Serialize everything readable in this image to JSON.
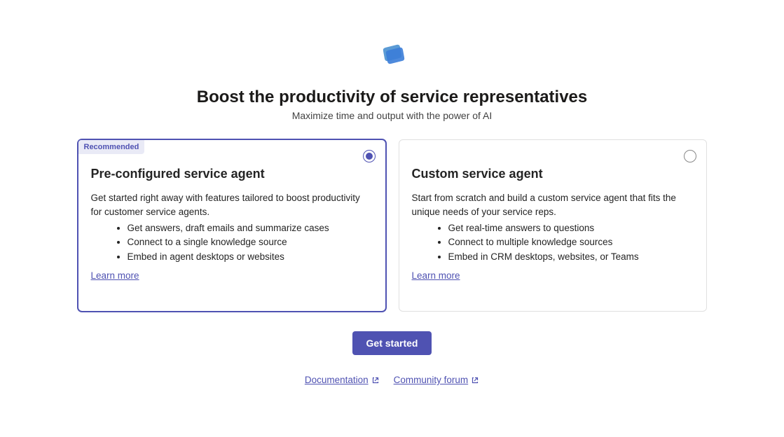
{
  "header": {
    "title": "Boost the productivity of service representatives",
    "subtitle": "Maximize time and output with the power of AI"
  },
  "cards": [
    {
      "badge": "Recommended",
      "title": "Pre-configured service agent",
      "description": "Get started right away with features tailored to boost productivity for customer service agents.",
      "bullets": [
        "Get answers, draft emails and summarize cases",
        "Connect to a single knowledge source",
        "Embed in agent desktops or websites"
      ],
      "learn_more": "Learn more",
      "selected": true
    },
    {
      "title": "Custom service agent",
      "description": "Start from scratch and build a custom service agent that fits the unique needs of your service reps.",
      "bullets": [
        "Get real-time answers to questions",
        "Connect to multiple knowledge sources",
        "Embed in CRM desktops, websites, or Teams"
      ],
      "learn_more": "Learn more",
      "selected": false
    }
  ],
  "cta": {
    "label": "Get started"
  },
  "footer": {
    "documentation": "Documentation",
    "community": "Community forum"
  }
}
